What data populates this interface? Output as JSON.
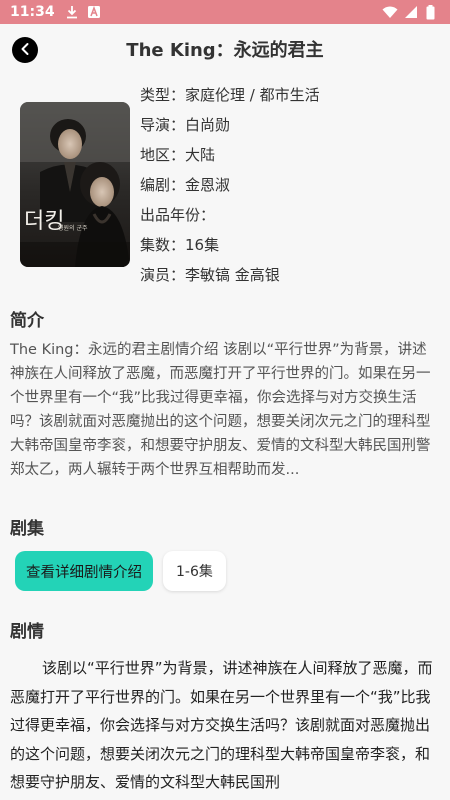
{
  "status_bar": {
    "time": "11:34",
    "bg_color": "#e4838b",
    "left_icons": [
      "download-icon",
      "font-icon"
    ],
    "right_icons": [
      "wifi-icon",
      "signal-icon",
      "battery-icon"
    ]
  },
  "header": {
    "title": "The King：永远的君主",
    "back_icon": "chevron-left-icon"
  },
  "drama": {
    "poster_icon": "drama-poster",
    "meta": [
      {
        "label": "类型：",
        "value": "家庭伦理 / 都市生活"
      },
      {
        "label": "导演：",
        "value": "白尚勋"
      },
      {
        "label": "地区：",
        "value": "大陆"
      },
      {
        "label": "编剧：",
        "value": "金恩淑"
      },
      {
        "label": "出品年份：",
        "value": ""
      },
      {
        "label": "集数：",
        "value": "16集"
      },
      {
        "label": "演员：",
        "value": "李敏镐 金高银"
      }
    ]
  },
  "synopsis": {
    "heading": "简介",
    "text": "The King：永远的君主剧情介绍 该剧以“平行世界”为背景，讲述神族在人间释放了恶魔，而恶魔打开了平行世界的门。如果在另一个世界里有一个“我”比我过得更幸福，你会选择与对方交换生活吗？该剧就面对恶魔抛出的这个问题，想要关闭次元之门的理科型大韩帝国皇帝李衮，和想要守护朋友、爱情的文科型大韩民国刑警郑太乙，两人辗转于两个世界互相帮助而发..."
  },
  "episodes": {
    "heading": "剧集",
    "detail_button": "查看详细剧情介绍",
    "chips": [
      "1-6集"
    ],
    "accent": "#23d3b7"
  },
  "plot": {
    "heading": "剧情",
    "text": "该剧以“平行世界”为背景，讲述神族在人间释放了恶魔，而恶魔打开了平行世界的门。如果在另一个世界里有一个“我”比我过得更幸福，你会选择与对方交换生活吗？该剧就面对恶魔抛出的这个问题，想要关闭次元之门的理科型大韩帝国皇帝李衮，和想要守护朋友、爱情的文科型大韩民国刑"
  }
}
